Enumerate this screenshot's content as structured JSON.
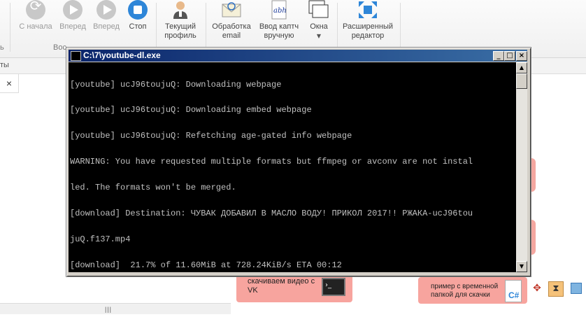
{
  "ribbon": {
    "buttons": [
      {
        "label": "С начала"
      },
      {
        "label": "Вперед"
      },
      {
        "label": "Вперед"
      },
      {
        "label": "Стоп"
      },
      {
        "label": "Текущий профиль"
      },
      {
        "label": "Обработка email"
      },
      {
        "label": "Ввод каптч вручную"
      },
      {
        "label": "Окна"
      },
      {
        "label": "Расширенный редактор"
      }
    ],
    "group_left_fragment": "ь",
    "group_playback_fragment": "Вос",
    "tab_fragment": "ты"
  },
  "document_tab": {
    "close_glyph": "×"
  },
  "console": {
    "title": "C:\\7\\youtube-dl.exe",
    "lines": [
      "[youtube] ucJ96toujuQ: Downloading webpage",
      "[youtube] ucJ96toujuQ: Downloading embed webpage",
      "[youtube] ucJ96toujuQ: Refetching age-gated info webpage",
      "WARNING: You have requested multiple formats but ffmpeg or avconv are not instal",
      "led. The formats won't be merged.",
      "[download] Destination: ЧУВАК ДОБАВИЛ В МАСЛО ВОДУ! ПРИКОЛ 2017!! РЖАКА-ucJ96tou",
      "juQ.f137.mp4",
      "[download]  21.7% of 11.60MiB at 728.24KiB/s ETA 00:12"
    ]
  },
  "canvas": {
    "card_vk": "скачиваем видео с VK",
    "card_temp": "пример с временной папкой для скачки",
    "csharp_badge": "C#"
  },
  "colors": {
    "console_bg": "#000000",
    "console_text": "#c0c0c0",
    "title_active": "#0a246a",
    "card": "#f7a49e"
  }
}
